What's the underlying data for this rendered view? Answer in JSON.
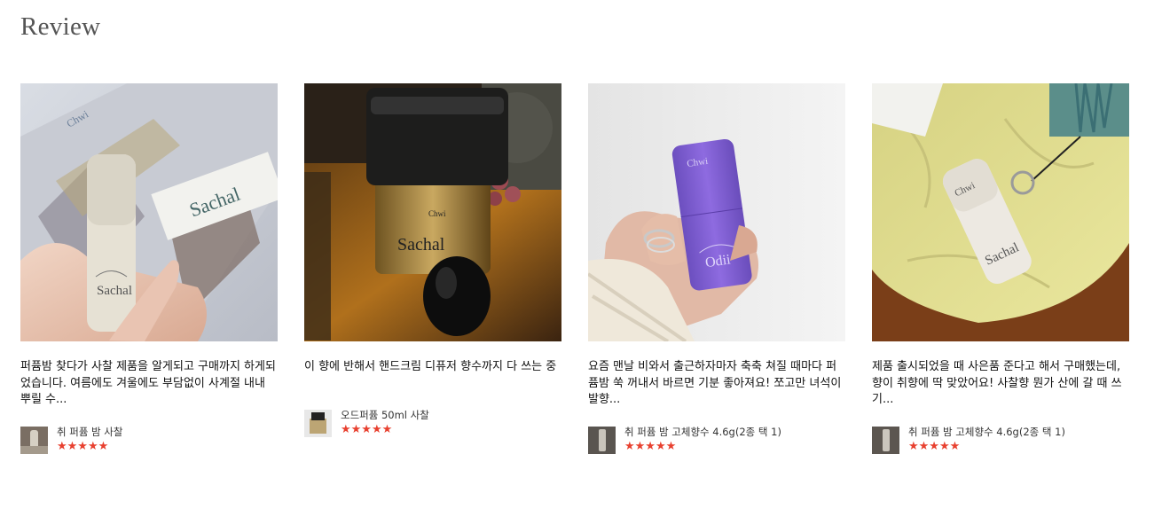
{
  "section": {
    "title": "Review"
  },
  "reviews": [
    {
      "text": "퍼퓸밤 찾다가 사찰 제품을 알게되고 구매까지 하게되었습니다. 여름에도 겨울에도 부담없이 사계절 내내 뿌릴 수...",
      "product": "취 퍼퓸 밤 사찰",
      "stars": "★★★★★",
      "photo_labels": [
        "Chwi",
        "Sachal"
      ]
    },
    {
      "text": "이 향에 반해서 핸드크림 디퓨저 향수까지 다 쓰는 중",
      "product": "오드퍼퓸 50ml 사찰",
      "stars": "★★★★★",
      "photo_labels": [
        "Chwi",
        "Sachal"
      ]
    },
    {
      "text": "요즘 맨날 비와서 출근하자마자 축축 쳐질 때마다 퍼퓸밤 쑥 꺼내서 바르면 기분 좋아져요! 쪼고만 녀석이 발향...",
      "product": "취 퍼퓸 밤 고체향수 4.6g(2종 택 1)",
      "stars": "★★★★★",
      "photo_labels": [
        "Chwi",
        "Odii"
      ]
    },
    {
      "text": "제품 출시되었을 때 사은품 준다고 해서 구매했는데, 향이 취향에 딱 맞았어요! 사찰향 뭔가 산에 갈 때 쓰기...",
      "product": "취 퍼퓸 밤 고체향수 4.6g(2종 택 1)",
      "stars": "★★★★★",
      "photo_labels": [
        "Chwi",
        "Sachal"
      ]
    }
  ],
  "colors": {
    "star": "#e8402f",
    "title": "#555555",
    "text": "#111111"
  }
}
